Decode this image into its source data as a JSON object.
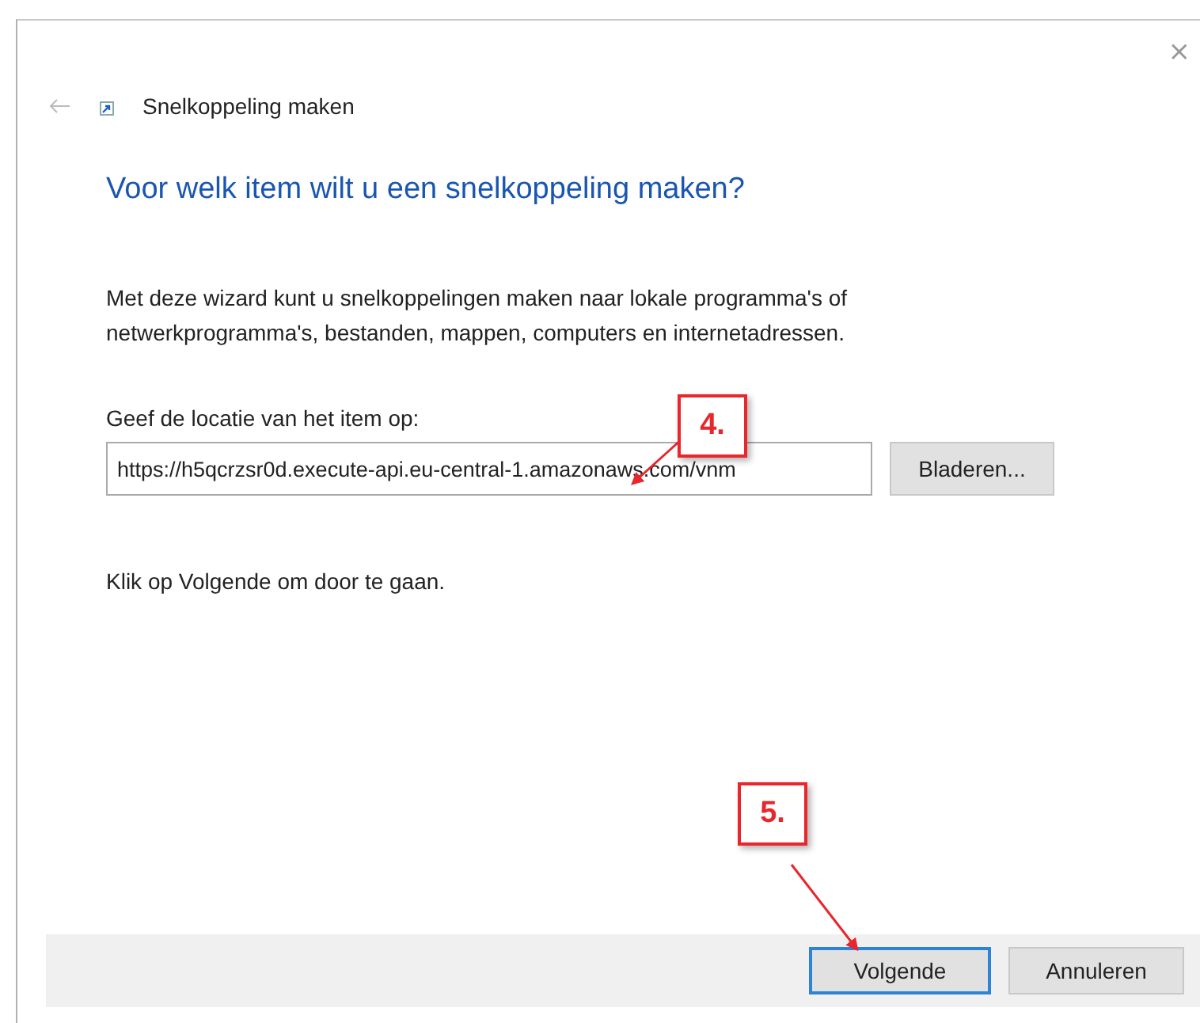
{
  "window": {
    "title": "Snelkoppeling maken",
    "back_enabled": false,
    "close": "×"
  },
  "heading": "Voor welk item wilt u een snelkoppeling maken?",
  "description": "Met deze wizard kunt u snelkoppelingen maken naar lokale programma's of netwerkprogramma's, bestanden, mappen, computers en internetadressen.",
  "location": {
    "label": "Geef de locatie van het item op:",
    "value": "https://h5qcrzsr0d.execute-api.eu-central-1.amazonaws.com/vnm",
    "browse_button": "Bladeren..."
  },
  "hint": "Klik op Volgende om door te gaan.",
  "buttons": [
    {
      "label": "Volgende",
      "default": true
    },
    {
      "label": "Annuleren",
      "default": false
    }
  ],
  "callouts": [
    {
      "label": "4."
    },
    {
      "label": "5."
    }
  ]
}
